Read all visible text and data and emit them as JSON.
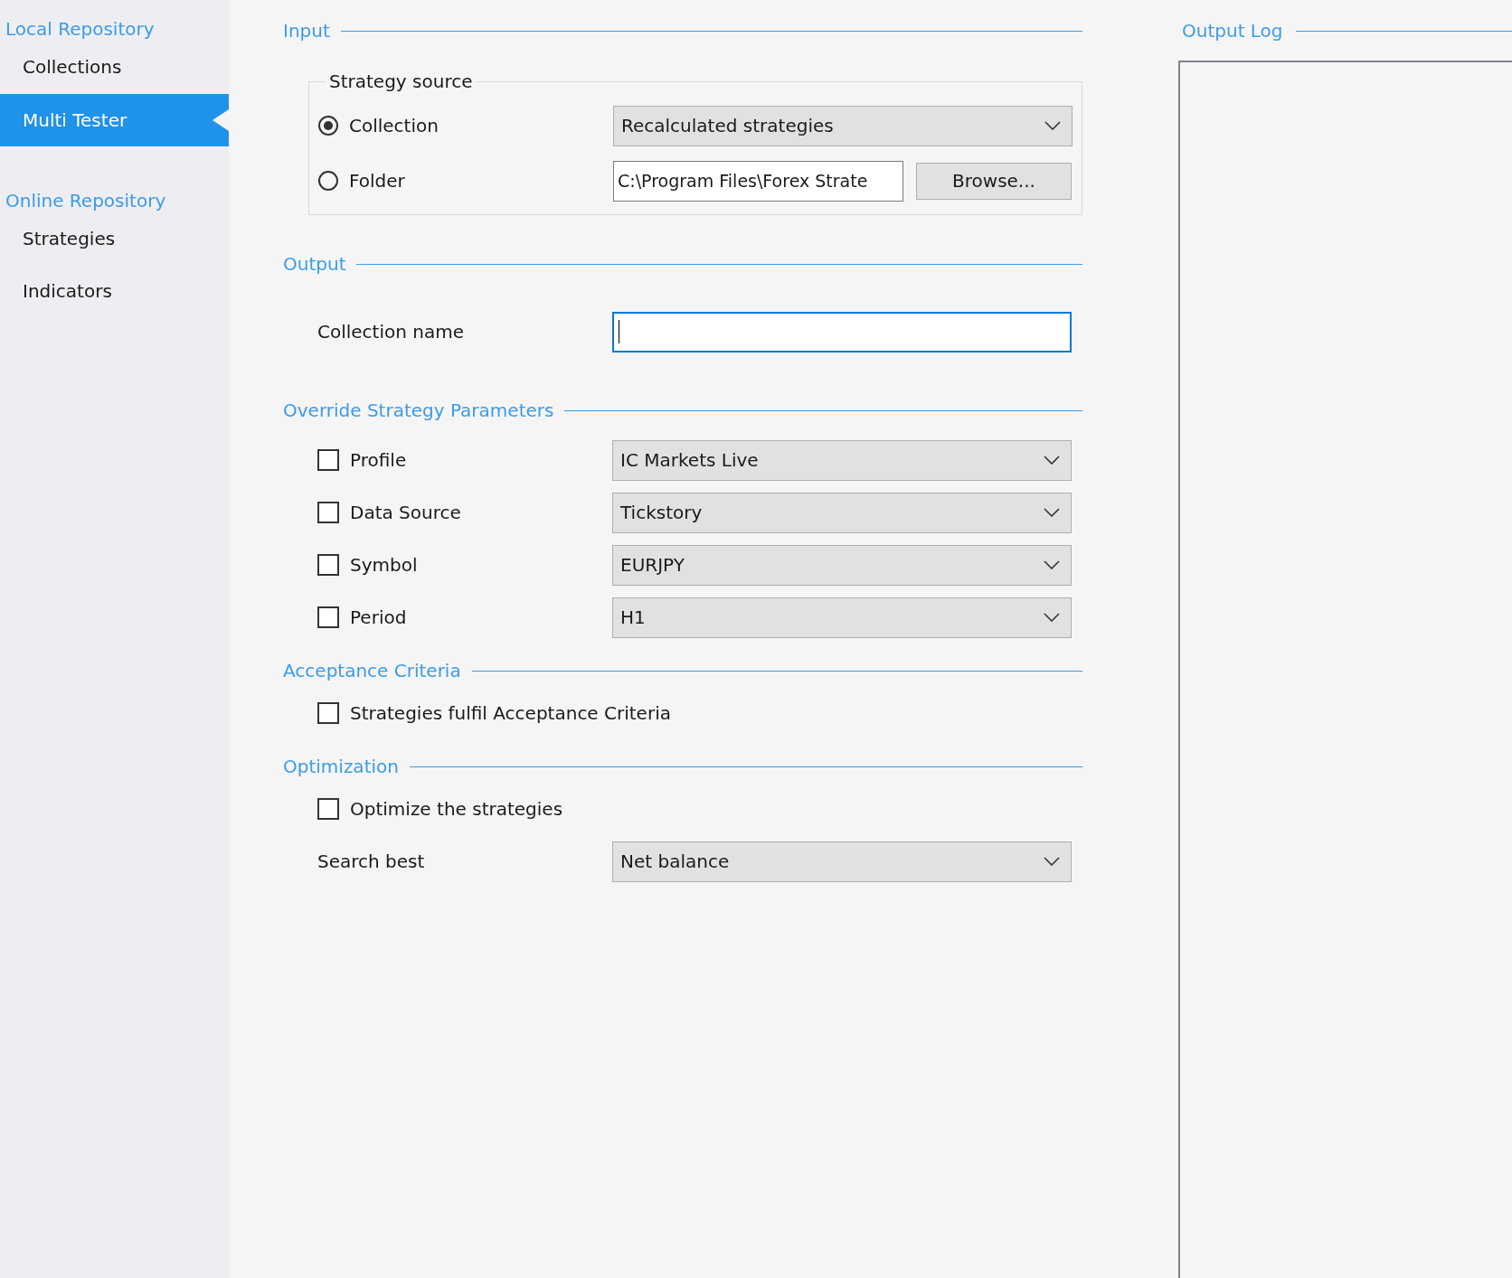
{
  "sidebar": [
    {
      "heading": "Local Repository",
      "items": [
        {
          "label": "Collections",
          "selected": false
        },
        {
          "label": "Multi Tester",
          "selected": true
        }
      ]
    },
    {
      "heading": "Online Repository",
      "items": [
        {
          "label": "Strategies",
          "selected": false
        },
        {
          "label": "Indicators",
          "selected": false
        }
      ]
    }
  ],
  "input": {
    "title": "Input",
    "group": {
      "title": "Strategy source",
      "options": [
        {
          "kind": "dropdown",
          "label": "Collection",
          "selected": true,
          "value": "Recalculated strategies"
        },
        {
          "kind": "path",
          "label": "Folder",
          "selected": false,
          "value": "C:\\Program Files\\Forex Strate",
          "button": "Browse..."
        }
      ]
    }
  },
  "sections": [
    {
      "title": "Output",
      "rows": [
        {
          "kind": "text",
          "label": "Collection name",
          "focused": true
        }
      ]
    },
    {
      "title": "Override Strategy Parameters",
      "rows": [
        {
          "kind": "checkbox",
          "label": "Profile",
          "checked": false,
          "value": "IC Markets Live"
        },
        {
          "kind": "checkbox",
          "label": "Data Source",
          "checked": false,
          "value": "Tickstory"
        },
        {
          "kind": "checkbox",
          "label": "Symbol",
          "checked": false,
          "value": "EURJPY"
        },
        {
          "kind": "checkbox",
          "label": "Period",
          "checked": false,
          "value": "H1"
        }
      ]
    },
    {
      "title": "Acceptance Criteria",
      "rows": [
        {
          "kind": "checkbox",
          "label": "Strategies fulfil Acceptance Criteria",
          "checked": false
        }
      ]
    },
    {
      "title": "Optimization",
      "rows": [
        {
          "kind": "checkbox",
          "label": "Optimize the strategies",
          "checked": false
        },
        {
          "kind": "select",
          "label": "Search best",
          "value": "Net balance"
        }
      ]
    }
  ],
  "output_log": {
    "title": "Output Log"
  }
}
